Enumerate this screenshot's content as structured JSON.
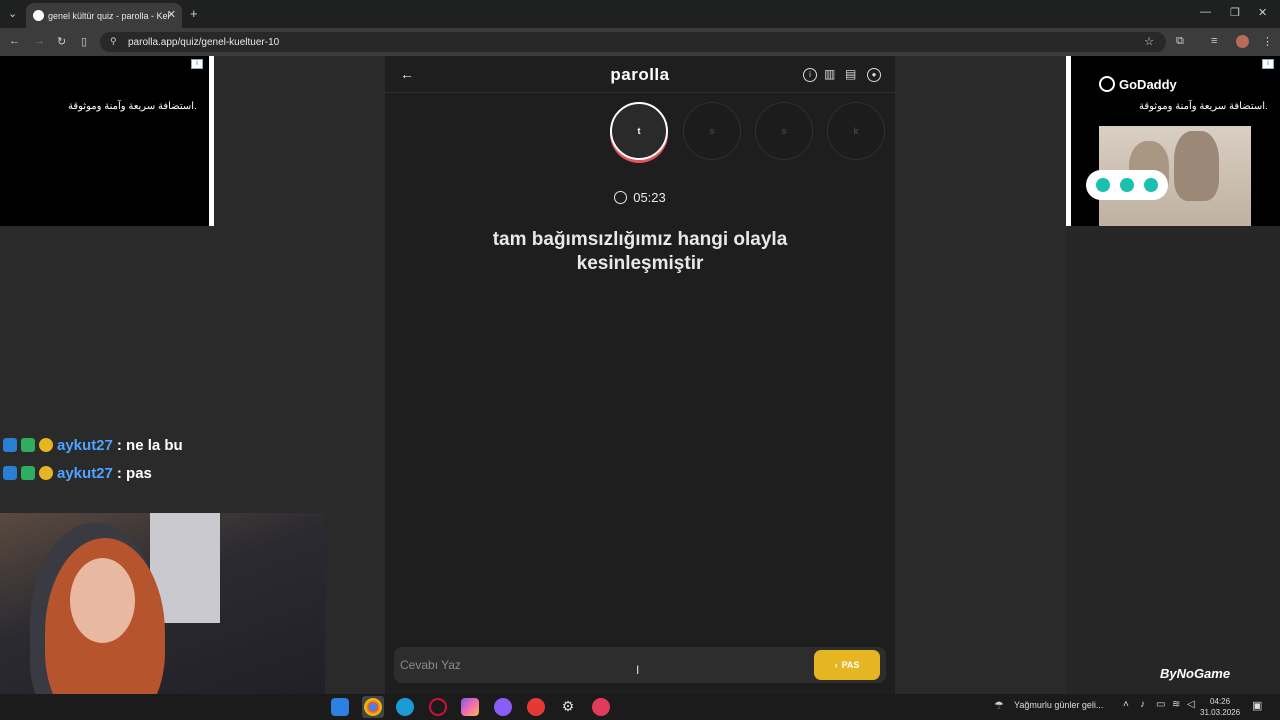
{
  "browser": {
    "tab_title": "genel kültür quiz - parolla - Kel",
    "url": "parolla.app/quiz/genel-kueltuer-10"
  },
  "ads": {
    "left_text": "استضافة سريعة وآمنة وموثوقة.",
    "right_brand": "GoDaddy",
    "right_text": "استضافة سريعة وآمنة وموثوقة."
  },
  "app": {
    "logo": "parolla",
    "letters": [
      "t",
      "s",
      "s",
      "k"
    ],
    "active_letter_index": 0,
    "timer": "05:23",
    "question_line1": "tam bağımsızlığımız hangi olayla",
    "question_line2": "kesinleşmiştir",
    "answer_placeholder": "Cevabı Yaz",
    "pass_label": "PAS"
  },
  "chat": [
    {
      "user": "aykut27",
      "message": ": ne la bu"
    },
    {
      "user": "aykut27",
      "message": ": pas"
    }
  ],
  "watermark": "ByNoGame",
  "taskbar": {
    "weather": "Yağmurlu günler geli...",
    "time": "04:26",
    "date": "31.03.2026"
  },
  "colors": {
    "accent_yellow": "#e6b522",
    "active_ring": "#e0565b",
    "chat_user": "#4ea3ff"
  }
}
